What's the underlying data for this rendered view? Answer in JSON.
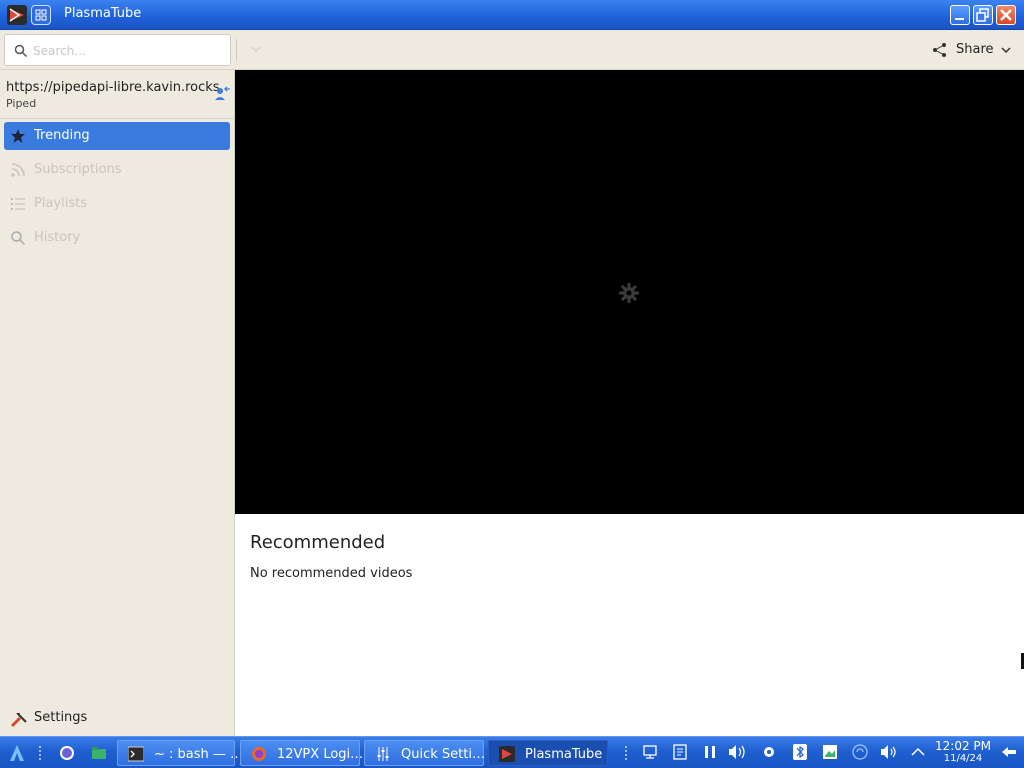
{
  "window": {
    "title": "PlasmaTube"
  },
  "toolbar": {
    "search_placeholder": "Search…",
    "share_label": "Share"
  },
  "sidebar": {
    "instance_url": "https://pipedapi-libre.kavin.rocks",
    "instance_type": "Piped",
    "items": [
      {
        "label": "Trending",
        "icon": "star-icon",
        "state": "active"
      },
      {
        "label": "Subscriptions",
        "icon": "rss-icon",
        "state": "disabled"
      },
      {
        "label": "Playlists",
        "icon": "playlist-icon",
        "state": "disabled"
      },
      {
        "label": "History",
        "icon": "search-icon",
        "state": "disabled"
      }
    ],
    "settings_label": "Settings"
  },
  "content": {
    "recommended_title": "Recommended",
    "recommended_empty": "No recommended videos"
  },
  "taskbar": {
    "tasks": [
      {
        "label": "~ : bash — …",
        "icon": "terminal-icon"
      },
      {
        "label": "12VPX Logi…",
        "icon": "firefox-icon"
      },
      {
        "label": "Quick Setti…",
        "icon": "settings-sliders-icon"
      },
      {
        "label": "PlasmaTube",
        "icon": "plasmatube-icon",
        "active": true
      }
    ],
    "clock_time": "12:02 PM",
    "clock_date": "11/4/24"
  },
  "colors": {
    "accent": "#3a7be0",
    "titlebar": "#1f60d8",
    "sidebar_bg": "#eeeae0",
    "player_bg": "#000000"
  }
}
